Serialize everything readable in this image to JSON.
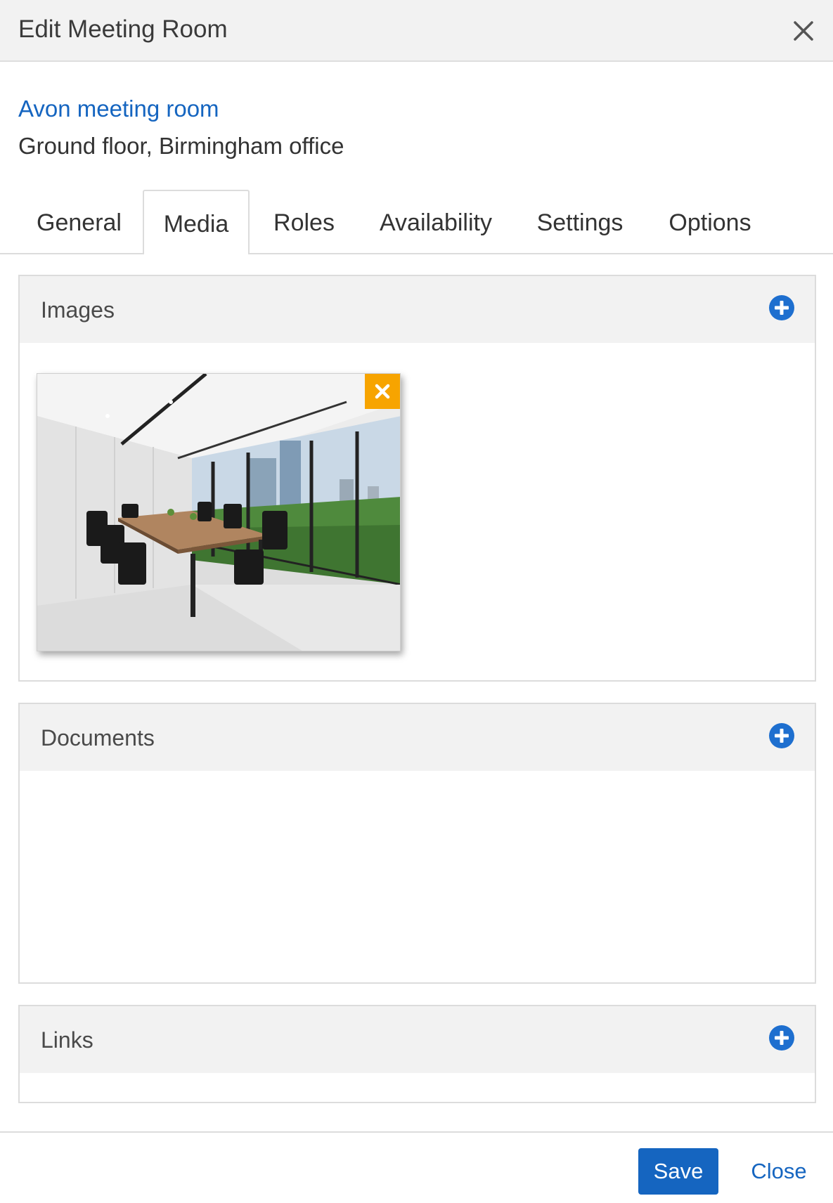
{
  "header": {
    "title": "Edit Meeting Room",
    "close_icon": "close-icon"
  },
  "room": {
    "name": "Avon meeting room",
    "location": "Ground floor, Birmingham office"
  },
  "tabs": [
    {
      "label": "General",
      "active": false
    },
    {
      "label": "Media",
      "active": true
    },
    {
      "label": "Roles",
      "active": false
    },
    {
      "label": "Availability",
      "active": false
    },
    {
      "label": "Settings",
      "active": false
    },
    {
      "label": "Options",
      "active": false
    }
  ],
  "sections": {
    "images": {
      "title": "Images",
      "add_icon": "plus-circle-icon"
    },
    "documents": {
      "title": "Documents",
      "add_icon": "plus-circle-icon"
    },
    "links": {
      "title": "Links",
      "add_icon": "plus-circle-icon"
    }
  },
  "image_remove_icon": "close-icon",
  "footer": {
    "save_label": "Save",
    "close_label": "Close"
  },
  "colors": {
    "primary": "#1565c0",
    "remove_badge": "#f7a400",
    "header_bg": "#f2f2f2"
  }
}
